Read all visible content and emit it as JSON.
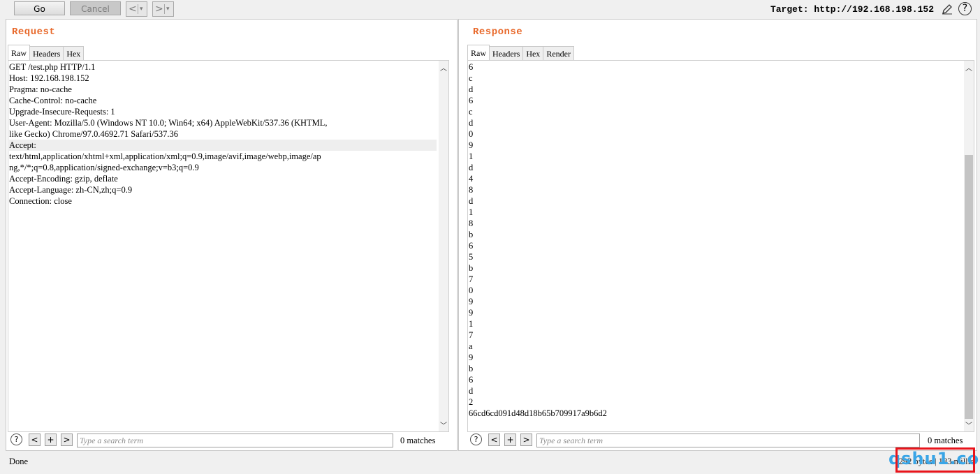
{
  "toolbar": {
    "go_label": "Go",
    "cancel_label": "Cancel",
    "back_glyph": "<",
    "forward_glyph": ">",
    "dropdown_glyph": "▾",
    "target_label": "Target: http://192.168.198.152",
    "help_glyph": "?"
  },
  "request": {
    "title": "Request",
    "tabs": [
      "Raw",
      "Headers",
      "Hex"
    ],
    "active_tab": "Raw",
    "lines": [
      "GET /test.php HTTP/1.1",
      "Host: 192.168.198.152",
      "Pragma: no-cache",
      "Cache-Control: no-cache",
      "Upgrade-Insecure-Requests: 1",
      "User-Agent: Mozilla/5.0 (Windows NT 10.0; Win64; x64) AppleWebKit/537.36 (KHTML,",
      "like Gecko) Chrome/97.0.4692.71 Safari/537.36",
      "Accept:",
      "text/html,application/xhtml+xml,application/xml;q=0.9,image/avif,image/webp,image/ap",
      "ng,*/*;q=0.8,application/signed-exchange;v=b3;q=0.9",
      "Accept-Encoding: gzip, deflate",
      "Accept-Language: zh-CN,zh;q=0.9",
      "Connection: close"
    ],
    "highlighted_line": 7,
    "search": {
      "placeholder": "Type a search term",
      "matches": "0 matches"
    }
  },
  "response": {
    "title": "Response",
    "tabs": [
      "Raw",
      "Headers",
      "Hex",
      "Render"
    ],
    "active_tab": "Raw",
    "lines": [
      "6",
      "c",
      "d",
      "6",
      "c",
      "d",
      "0",
      "9",
      "1",
      "d",
      "4",
      "8",
      "d",
      "1",
      "8",
      "b",
      "6",
      "5",
      "b",
      "7",
      "0",
      "9",
      "9",
      "1",
      "7",
      "a",
      "9",
      "b",
      "6",
      "d",
      "2",
      "66cd6cd091d48d18b65b709917a9b6d2"
    ],
    "search": {
      "placeholder": "Type a search term",
      "matches": "0 matches"
    }
  },
  "search_controls": {
    "help": "?",
    "prev": "<",
    "add": "+",
    "next": ">"
  },
  "status": {
    "left": "Done",
    "right": "292 bytes | 183 millis",
    "watermark": "qshu1.com"
  },
  "colors": {
    "panel_title": "#e8692b",
    "highlight_box": "#e8141b",
    "watermark": "#3aa5e6"
  }
}
